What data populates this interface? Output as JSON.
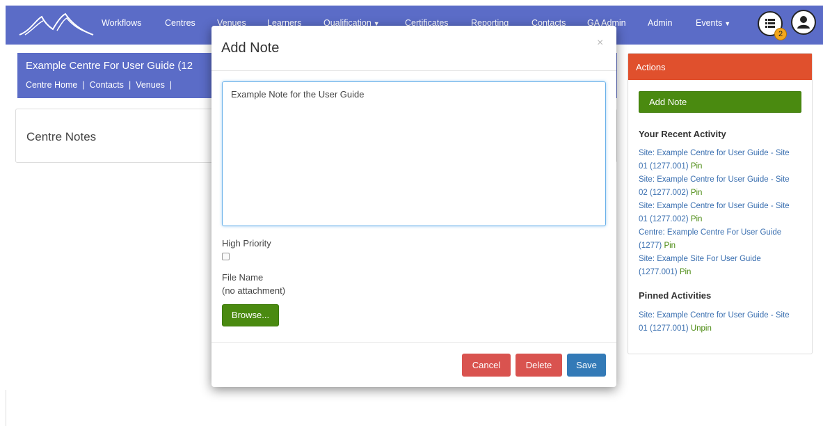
{
  "colors": {
    "navbar": "#5b6cc7",
    "actions_header": "#e0502d",
    "green": "#4a8a10",
    "danger": "#d9534f",
    "primary": "#337ab7",
    "badge": "#f4a71d"
  },
  "nav": {
    "items": [
      "Workflows",
      "Centres",
      "Venues",
      "Learners",
      "Qualification",
      "Certificates",
      "Reporting",
      "Contacts",
      "GA Admin",
      "Admin",
      "Events"
    ],
    "notification_count": "2",
    "icons": [
      "mountain-logo",
      "list-icon",
      "user-icon"
    ]
  },
  "centre": {
    "title": "Example Centre For User Guide (12",
    "links": [
      "Centre Home",
      "Contacts",
      "Venues",
      "|"
    ]
  },
  "notes_panel": {
    "title": "Centre Notes"
  },
  "modal": {
    "title": "Add Note",
    "close": "×",
    "note_text": "Example Note for the User Guide",
    "high_priority_label": "High Priority",
    "high_priority_checked": false,
    "file_name_label": "File Name",
    "file_name_value": "(no attachment)",
    "browse_label": "Browse...",
    "cancel_label": "Cancel",
    "delete_label": "Delete",
    "save_label": "Save"
  },
  "actions": {
    "header": "Actions",
    "add_note_label": "Add Note",
    "recent_title": "Your Recent Activity",
    "recent": [
      {
        "text": "Site: Example Centre for User Guide - Site 01 (1277.001)",
        "pin": "Pin"
      },
      {
        "text": "Site: Example Centre for User Guide - Site 02 (1277.002)",
        "pin": "Pin"
      },
      {
        "text": "Site: Example Centre for User Guide - Site 01 (1277.002)",
        "pin": "Pin"
      },
      {
        "text": "Centre: Example Centre For User Guide (1277)",
        "pin": "Pin"
      },
      {
        "text": "Site: Example Site For User Guide (1277.001)",
        "pin": "Pin"
      }
    ],
    "pinned_title": "Pinned Activities",
    "pinned": [
      {
        "text": "Site: Example Centre for User Guide - Site 01 (1277.001)",
        "pin": "Unpin"
      }
    ]
  }
}
